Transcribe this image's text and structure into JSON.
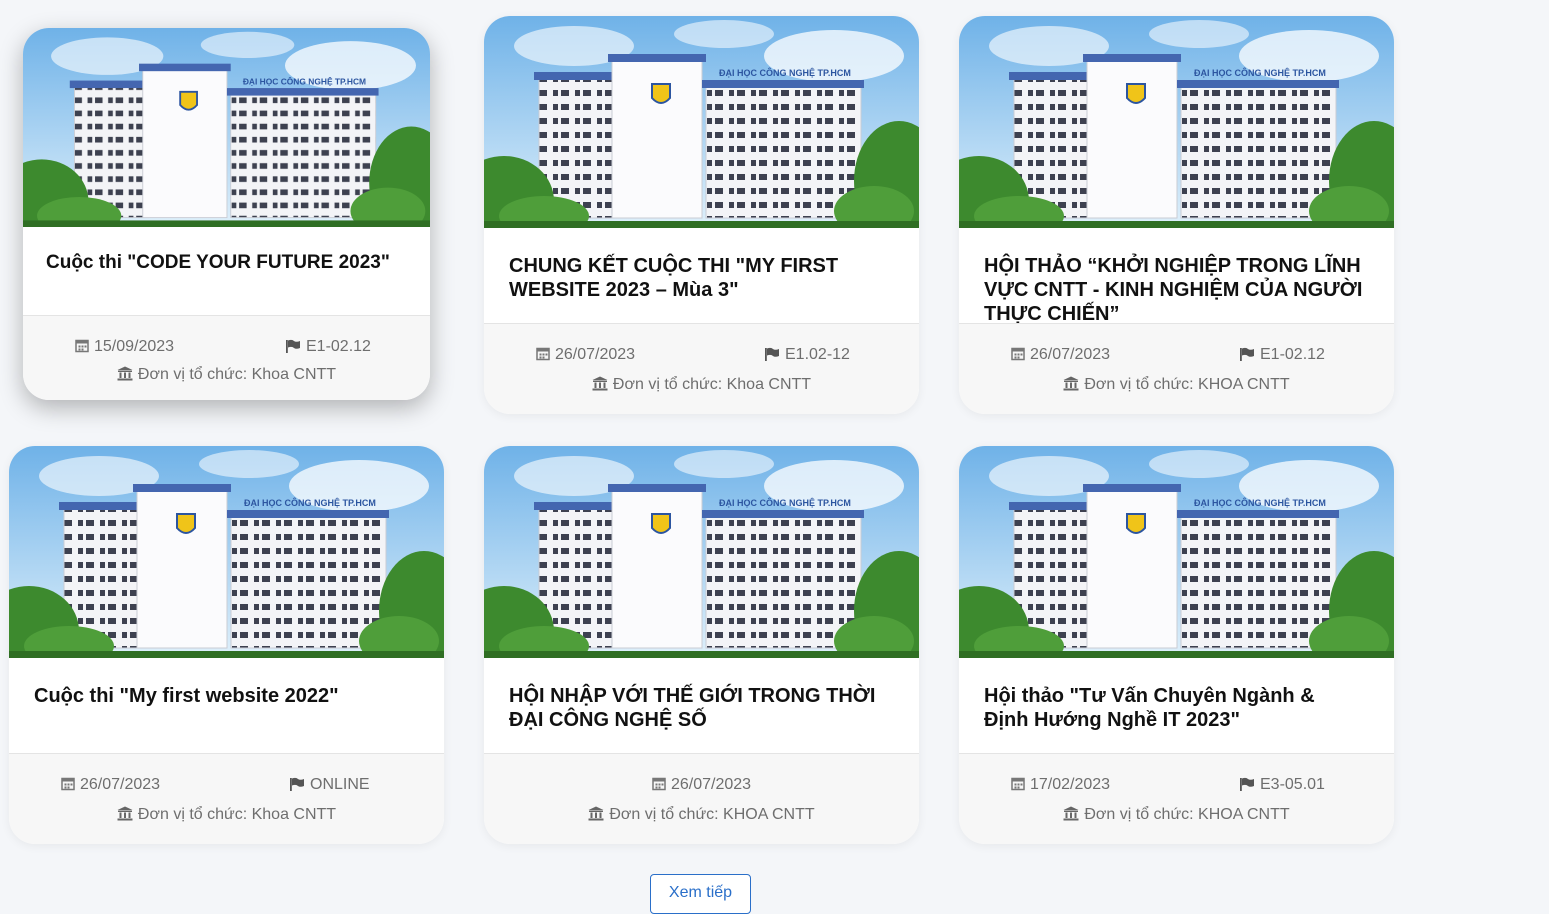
{
  "events": [
    {
      "title": "Cuộc thi \"CODE YOUR FUTURE 2023\"",
      "date": "15/09/2023",
      "room": "E1-02.12",
      "org": "Đơn vị tổ chức: Khoa CNTT"
    },
    {
      "title": "CHUNG KẾT CUỘC THI \"MY FIRST WEBSITE 2023 – Mùa 3\"",
      "date": "26/07/2023",
      "room": "E1.02-12",
      "org": "Đơn vị tổ chức: Khoa CNTT"
    },
    {
      "title": "HỘI THẢO “KHỞI NGHIỆP TRONG LĨNH VỰC CNTT - KINH NGHIỆM CỦA NGƯỜI THỰC CHIẾN”",
      "date": "26/07/2023",
      "room": "E1-02.12",
      "org": "Đơn vị tổ chức: KHOA CNTT"
    },
    {
      "title": "Cuộc thi \"My first website 2022\"",
      "date": "26/07/2023",
      "room": "ONLINE",
      "org": "Đơn vị tổ chức: Khoa CNTT"
    },
    {
      "title": "HỘI NHẬP VỚI THẾ GIỚI TRONG THỜI ĐẠI CÔNG NGHỆ SỐ",
      "date": "26/07/2023",
      "room": "",
      "org": "Đơn vị tổ chức: KHOA CNTT"
    },
    {
      "title": "Hội thảo \"Tư Vấn Chuyên Ngành & Định Hướng Nghề IT 2023\"",
      "date": "17/02/2023",
      "room": "E3-05.01",
      "org": "Đơn vị tổ chức: KHOA CNTT"
    }
  ],
  "building_sign": "ĐẠI HỌC CÔNG NGHỆ TP.HCM",
  "more_button": "Xem tiếp",
  "colors": {
    "accent": "#2a6fc9",
    "sky": "#8ec3ea",
    "tree": "#3d8a2e"
  },
  "icons": {
    "date": "calendar-icon",
    "room": "flag-icon",
    "org": "institution-icon"
  }
}
